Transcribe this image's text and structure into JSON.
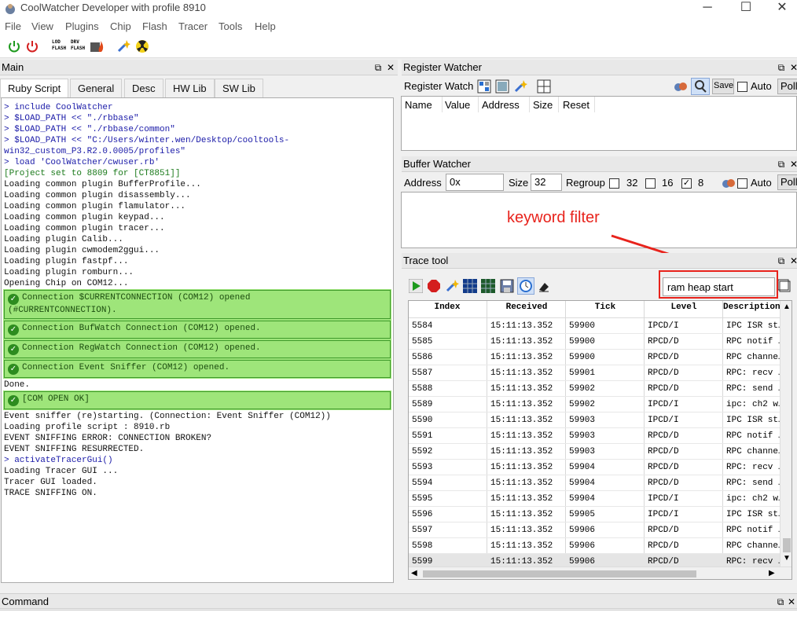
{
  "window": {
    "title": "CoolWatcher Developer with profile 8910",
    "min": "─",
    "max": "☐",
    "close": "✕"
  },
  "menu": [
    "File",
    "View",
    "Plugins",
    "Chip",
    "Flash",
    "Tracer",
    "Tools",
    "Help"
  ],
  "toolbar": {
    "icons": [
      "power-on-icon",
      "power-off-icon",
      "lod-flash-icon",
      "drv-flash-icon",
      "fastpf-flash-icon",
      "wand-icon",
      "radiation-icon"
    ],
    "lod": "LOD FLASH",
    "drv": "DRV FLASH"
  },
  "main_dock": {
    "title": "Main",
    "float": "⧉",
    "close": "✕",
    "tabs": [
      "Ruby Script",
      "General",
      "Desc",
      "HW Lib",
      "SW Lib"
    ],
    "console": [
      {
        "t": "> include CoolWatcher",
        "k": "cmd"
      },
      {
        "t": "> $LOAD_PATH << \"./rbbase\"",
        "k": "cmd"
      },
      {
        "t": "> $LOAD_PATH << \"./rbbase/common\"",
        "k": "cmd"
      },
      {
        "t": "> $LOAD_PATH << \"C:/Users/winter.wen/Desktop/cooltools-",
        "k": "cmd"
      },
      {
        "t": "win32_custom_P3.R2.0.0005/profiles\"",
        "k": "cmd"
      },
      {
        "t": "> load 'CoolWatcher/cwuser.rb'",
        "k": "cmd"
      },
      {
        "t": "[Project set to 8809 for [CT8851]]",
        "k": "proj"
      },
      {
        "t": "Loading common plugin BufferProfile...",
        "k": "out"
      },
      {
        "t": "Loading common plugin disassembly...",
        "k": "out"
      },
      {
        "t": "Loading common plugin flamulator...",
        "k": "out"
      },
      {
        "t": "Loading common plugin keypad...",
        "k": "out"
      },
      {
        "t": "Loading common plugin tracer...",
        "k": "out"
      },
      {
        "t": "Loading plugin Calib...",
        "k": "out"
      },
      {
        "t": "Loading plugin cwmodem2ggui...",
        "k": "out"
      },
      {
        "t": "Loading plugin fastpf...",
        "k": "out"
      },
      {
        "t": "Loading plugin romburn...",
        "k": "out"
      },
      {
        "t": "Opening Chip on COM12...",
        "k": "out"
      },
      {
        "t": "Connection $CURRENTCONNECTION (COM12) opened\n(#CURRENTCONNECTION).",
        "k": "ok"
      },
      {
        "t": "Connection BufWatch Connection (COM12) opened.",
        "k": "ok"
      },
      {
        "t": "Connection RegWatch Connection (COM12) opened.",
        "k": "ok"
      },
      {
        "t": "Connection Event Sniffer (COM12) opened.",
        "k": "ok"
      },
      {
        "t": "Done.",
        "k": "out"
      },
      {
        "t": "[COM OPEN OK]",
        "k": "ok"
      },
      {
        "t": "Event sniffer (re)starting. (Connection: Event Sniffer (COM12))",
        "k": "out"
      },
      {
        "t": "Loading profile script : 8910.rb",
        "k": "out"
      },
      {
        "t": "EVENT SNIFFING ERROR: CONNECTION BROKEN?",
        "k": "out"
      },
      {
        "t": "EVENT SNIFFING RESURRECTED.",
        "k": "out"
      },
      {
        "t": "> activateTracerGui()",
        "k": "cmd"
      },
      {
        "t": "Loading Tracer GUI ...",
        "k": "out"
      },
      {
        "t": "Tracer GUI loaded.",
        "k": "out"
      },
      {
        "t": "TRACE SNIFFING ON.",
        "k": "out"
      }
    ]
  },
  "register_watcher": {
    "title": "Register Watcher",
    "label": "Register Watch",
    "save": "Save",
    "auto": "Auto",
    "poll": "Poll",
    "columns": [
      "Name",
      "Value",
      "Address",
      "Size",
      "Reset"
    ]
  },
  "buffer_watcher": {
    "title": "Buffer Watcher",
    "address_label": "Address",
    "address_value": "0x",
    "size_label": "Size",
    "size_value": "32",
    "regroup_label": "Regroup",
    "opt32": "32",
    "opt16": "16",
    "opt8": "8",
    "opt8_checked": "✓",
    "auto": "Auto",
    "poll": "Poll"
  },
  "annotation": "keyword filter",
  "trace_tool": {
    "title": "Trace tool",
    "filter_value": "ram heap start",
    "columns": [
      "Index",
      "Received",
      "Tick",
      "Level",
      "Description"
    ],
    "rows": [
      [
        "5584",
        "15:11:13.352",
        "59900",
        "IPCD/I",
        "IPC ISR st…"
      ],
      [
        "5585",
        "15:11:13.352",
        "59900",
        "RPCD/D",
        "RPC notif …"
      ],
      [
        "5586",
        "15:11:13.352",
        "59900",
        "RPCD/D",
        "RPC channe…"
      ],
      [
        "5587",
        "15:11:13.352",
        "59901",
        "RPCD/D",
        "RPC: recv …"
      ],
      [
        "5588",
        "15:11:13.352",
        "59902",
        "RPCD/D",
        "RPC: send …"
      ],
      [
        "5589",
        "15:11:13.352",
        "59902",
        "IPCD/I",
        "ipc: ch2 w…"
      ],
      [
        "5590",
        "15:11:13.352",
        "59903",
        "IPCD/I",
        "IPC ISR st…"
      ],
      [
        "5591",
        "15:11:13.352",
        "59903",
        "RPCD/D",
        "RPC notif …"
      ],
      [
        "5592",
        "15:11:13.352",
        "59903",
        "RPCD/D",
        "RPC channe…"
      ],
      [
        "5593",
        "15:11:13.352",
        "59904",
        "RPCD/D",
        "RPC: recv …"
      ],
      [
        "5594",
        "15:11:13.352",
        "59904",
        "RPCD/D",
        "RPC: send …"
      ],
      [
        "5595",
        "15:11:13.352",
        "59904",
        "IPCD/I",
        "ipc: ch2 w…"
      ],
      [
        "5596",
        "15:11:13.352",
        "59905",
        "IPCD/I",
        "IPC ISR st…"
      ],
      [
        "5597",
        "15:11:13.352",
        "59906",
        "RPCD/D",
        "RPC notif …"
      ],
      [
        "5598",
        "15:11:13.352",
        "59906",
        "RPCD/D",
        "RPC channe…"
      ],
      [
        "5599",
        "15:11:13.352",
        "59906",
        "RPCD/D",
        "RPC: recv …"
      ]
    ]
  },
  "command_dock": {
    "title": "Command"
  }
}
